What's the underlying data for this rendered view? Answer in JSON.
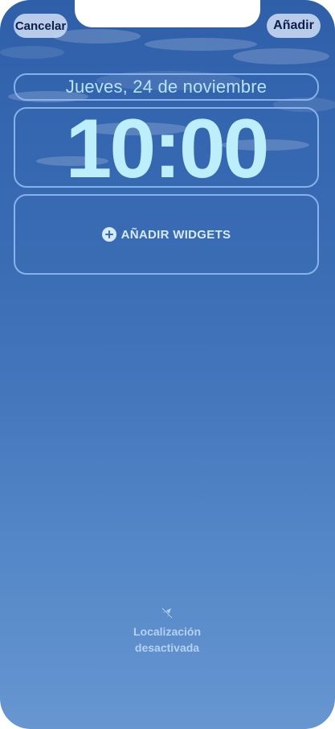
{
  "top_bar": {
    "cancel_label": "Cancelar",
    "add_label": "Añadir"
  },
  "lock_screen": {
    "date": "Jueves, 24 de noviembre",
    "time": "10:00",
    "add_widgets_label": "AÑADIR WIDGETS"
  },
  "footer": {
    "location_line1": "Localización",
    "location_line2": "desactivada",
    "location_icon": "location-off-icon"
  },
  "colors": {
    "background_top": "#2f5fa8",
    "background_bottom": "#6796d0",
    "frame_border": "#96bef5",
    "clock_text": "#bdeefc",
    "button_bg": "#c4d6f0",
    "button_text": "#0c1e4a"
  }
}
